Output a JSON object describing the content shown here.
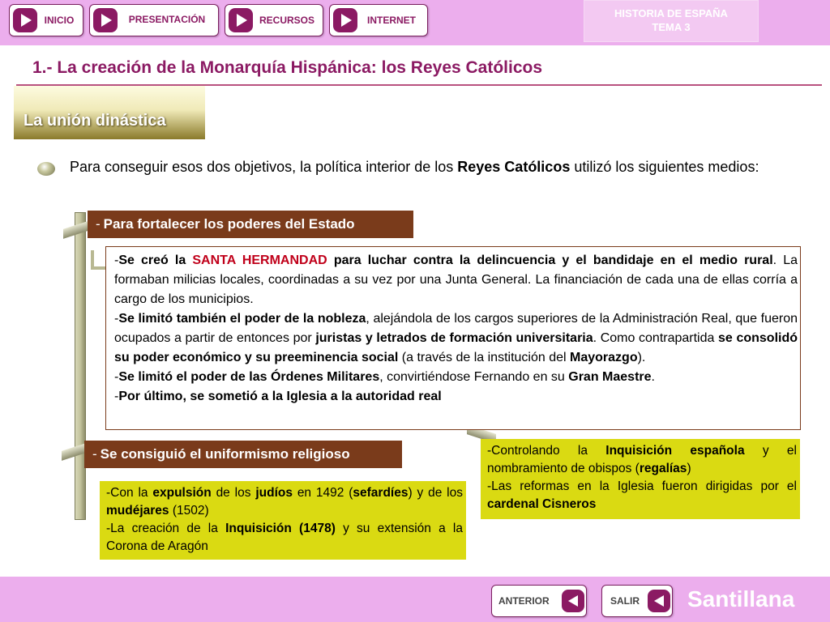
{
  "nav": {
    "inicio": "INICIO",
    "presentacion": "PRESENTACIÓN",
    "recursos": "RECURSOS",
    "internet": "INTERNET"
  },
  "course": {
    "line1": "HISTORIA DE ESPAÑA",
    "line2": "TEMA 3"
  },
  "title": "1.- La creación de la Monarquía Hispánica: los Reyes Católicos",
  "section": "La unión dinástica",
  "intro": {
    "a": "Para conseguir esos dos objetivos, la política interior de los ",
    "b": "Reyes Católicos",
    "c": " utilizó los siguientes medios:"
  },
  "header1": {
    "dash": "-",
    "text": "Para fortalecer los poderes del Estado"
  },
  "detail": {
    "p1": {
      "a": "-",
      "b": "Se creó la ",
      "c": "SANTA HERMANDAD",
      "d": " para luchar contra la delincuencia y el bandidaje en el medio rural",
      "e": ". La formaban milicias locales, coordinadas a su vez por una Junta General. La financiación de cada una de ellas corría a cargo de los municipios."
    },
    "p2": {
      "a": "-",
      "b": "Se limitó también el poder de la nobleza",
      "c": ", alejándola de los cargos superiores de la Administración Real, que fueron ocupados a partir de entonces por ",
      "d": "juristas y letrados de formación universitaria",
      "e": ". Como contrapartida ",
      "f": "se consolidó su poder económico y su preeminencia social",
      "g": " (a través de la institución del ",
      "h": "Mayorazgo",
      "i": ")."
    },
    "p3": {
      "a": "-",
      "b": "Se limitó el poder de las Órdenes Militares",
      "c": ", convirtiéndose Fernando en su ",
      "d": "Gran Maestre",
      "e": "."
    },
    "p4": {
      "a": "-",
      "b": "Por último, se sometió a la Iglesia a la autoridad real"
    }
  },
  "header2": {
    "dash": "-",
    "text": "Se consiguió el uniformismo religioso"
  },
  "box1": {
    "p1": {
      "a": "-Con la ",
      "b": "expulsión",
      "c": " de los ",
      "d": "judíos",
      "e": " en 1492 (",
      "f": "sefardíes",
      "g": ") y de los ",
      "h": "mudéjares",
      "i": " (1502)"
    },
    "p2": {
      "a": "-La creación de la ",
      "b": "Inquisición (1478)",
      "c": " y su extensión a la Corona de Aragón"
    }
  },
  "box2": {
    "p1": {
      "a": "-Controlando la ",
      "b": "Inquisición española",
      "c": " y el nombramiento de obispos (",
      "d": "regalías",
      "e": ")"
    },
    "p2": {
      "a": "-Las reformas en la Iglesia fueron dirigidas por el ",
      "b": "cardenal Cisneros"
    }
  },
  "footer": {
    "anterior": "ANTERIOR",
    "salir": "SALIR",
    "brand": "Santillana"
  },
  "colors": {
    "pink": "#ecaeed",
    "magenta": "#8b1a63",
    "brown": "#7a3b1b",
    "yellow": "#dada12",
    "red": "#c0001a"
  }
}
